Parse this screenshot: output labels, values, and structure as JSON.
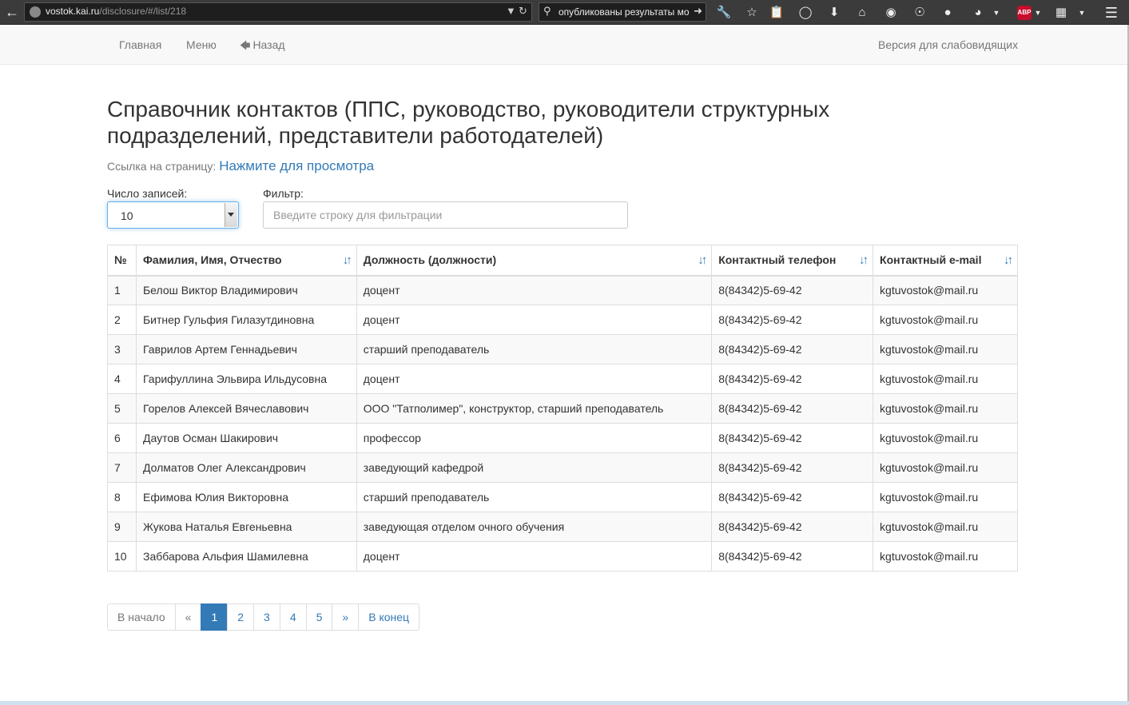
{
  "browser": {
    "url_host": "vostok.kai.ru",
    "url_prefix": "",
    "url_path": "/disclosure/#/list/218",
    "search_query": "опубликованы результаты мо",
    "abp_label": "ABP"
  },
  "navbar": {
    "home": "Главная",
    "menu": "Меню",
    "back": "Назад",
    "accessibility": "Версия для слабовидящих"
  },
  "page": {
    "title": "Справочник контактов (ППС, руководство, руководители структурных подразделений, представители работодателей)",
    "link_prefix": "Ссылка на страницу:",
    "link_text": "Нажмите для просмотра"
  },
  "controls": {
    "records_label": "Число записей:",
    "records_value": "10",
    "filter_label": "Фильтр:",
    "filter_placeholder": "Введите строку для фильтрации"
  },
  "table": {
    "headers": {
      "num": "№",
      "name": "Фамилия, Имя, Отчество",
      "position": "Должность (должности)",
      "phone": "Контактный телефон",
      "email": "Контактный e-mail"
    },
    "rows": [
      {
        "num": "1",
        "name": "Белош Виктор Владимирович",
        "position": "доцент",
        "phone": "8(84342)5-69-42",
        "email": "kgtuvostok@mail.ru"
      },
      {
        "num": "2",
        "name": "Битнер Гульфия Гилазутдиновна",
        "position": "доцент",
        "phone": "8(84342)5-69-42",
        "email": "kgtuvostok@mail.ru"
      },
      {
        "num": "3",
        "name": "Гаврилов Артем Геннадьевич",
        "position": "старший преподаватель",
        "phone": "8(84342)5-69-42",
        "email": "kgtuvostok@mail.ru"
      },
      {
        "num": "4",
        "name": "Гарифуллина Эльвира Ильдусовна",
        "position": "доцент",
        "phone": "8(84342)5-69-42",
        "email": "kgtuvostok@mail.ru"
      },
      {
        "num": "5",
        "name": "Горелов Алексей Вячеславович",
        "position": "ООО \"Татполимер\", конструктор, старший преподаватель",
        "phone": "8(84342)5-69-42",
        "email": "kgtuvostok@mail.ru"
      },
      {
        "num": "6",
        "name": "Даутов Осман Шакирович",
        "position": "профессор",
        "phone": "8(84342)5-69-42",
        "email": "kgtuvostok@mail.ru"
      },
      {
        "num": "7",
        "name": "Долматов Олег Александрович",
        "position": "заведующий кафедрой",
        "phone": "8(84342)5-69-42",
        "email": "kgtuvostok@mail.ru"
      },
      {
        "num": "8",
        "name": "Ефимова Юлия Викторовна",
        "position": "старший преподаватель",
        "phone": "8(84342)5-69-42",
        "email": "kgtuvostok@mail.ru"
      },
      {
        "num": "9",
        "name": "Жукова Наталья Евгеньевна",
        "position": "заведующая отделом очного обучения",
        "phone": "8(84342)5-69-42",
        "email": "kgtuvostok@mail.ru"
      },
      {
        "num": "10",
        "name": "Заббарова Альфия Шамилевна",
        "position": "доцент",
        "phone": "8(84342)5-69-42",
        "email": "kgtuvostok@mail.ru"
      }
    ]
  },
  "pagination": {
    "first": "В начало",
    "prev": "«",
    "pages": [
      "1",
      "2",
      "3",
      "4",
      "5"
    ],
    "active_page": "1",
    "next": "»",
    "last": "В конец"
  },
  "colors": {
    "link": "#337ab7",
    "navbar_bg": "#f8f8f8",
    "active_page_bg": "#337ab7"
  }
}
